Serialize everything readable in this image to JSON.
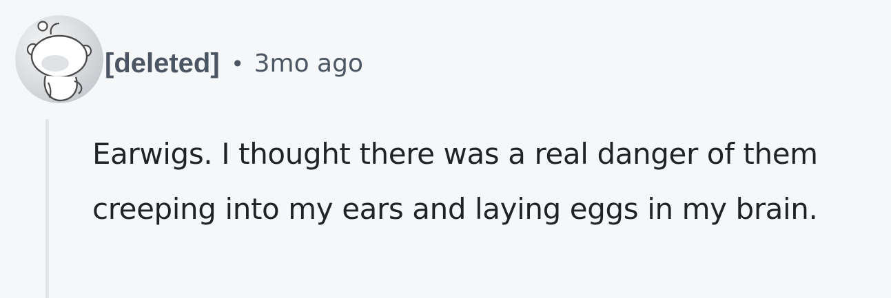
{
  "comment": {
    "author": "[deleted]",
    "separator": "•",
    "timestamp": "3mo ago",
    "avatar_icon": "reddit-snoo-deleted-icon",
    "body": "Earwigs. I thought there was a real danger of them creeping into my ears and laying eggs in my brain."
  },
  "colors": {
    "background": "#f6f7f8",
    "meta_text": "#4b5563",
    "body_text": "#1f2328",
    "thread_line": "#e3e5e8"
  }
}
